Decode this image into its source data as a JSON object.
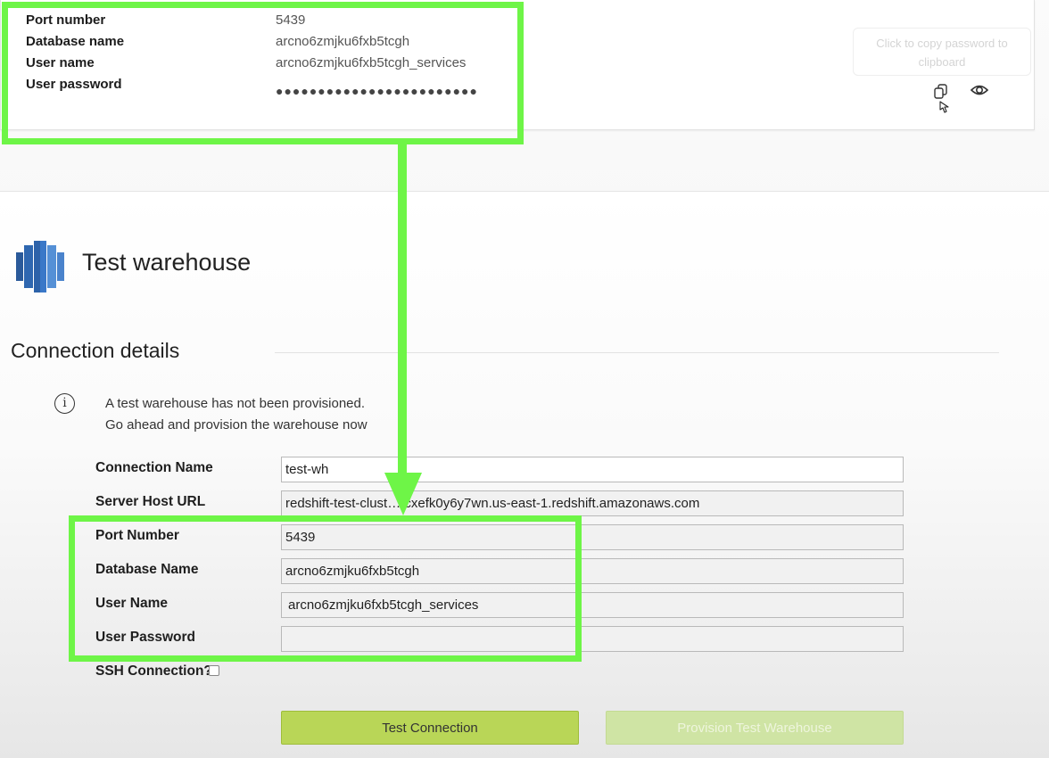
{
  "top_card": {
    "rows": [
      {
        "label": "Port number",
        "value": "5439"
      },
      {
        "label": "Database name",
        "value": "arcno6zmjku6fxb5tcgh"
      },
      {
        "label": "User name",
        "value": "arcno6zmjku6fxb5tcgh_services"
      },
      {
        "label": "User password",
        "value": "●●●●●●●●●●●●●●●●●●●●●●●●"
      }
    ],
    "copy_tooltip": "Click to copy password to clipboard",
    "icons": {
      "copy": "copy-icon",
      "show": "eye-icon"
    }
  },
  "warehouse": {
    "title": "Test warehouse",
    "icon": "redshift-logo-icon"
  },
  "connection": {
    "section_title": "Connection details",
    "info_line_1": "A test warehouse has not been provisioned.",
    "info_line_2": "Go ahead and provision the warehouse now",
    "fields": {
      "connection_name": {
        "label": "Connection Name",
        "value": "test-wh"
      },
      "server_host_url": {
        "label": "Server Host URL",
        "value": "redshift-test-clust….cxefk0y6y7wn.us-east-1.redshift.amazonaws.com"
      },
      "port_number": {
        "label": "Port Number",
        "value": "5439"
      },
      "database_name": {
        "label": "Database Name",
        "value": "arcno6zmjku6fxb5tcgh"
      },
      "user_name": {
        "label": "User Name",
        "value": "arcno6zmjku6fxb5tcgh_services"
      },
      "user_password": {
        "label": "User Password",
        "value": ""
      }
    },
    "ssh_label": "SSH Connection?",
    "ssh_checked": false,
    "test_button": "Test Connection",
    "provision_button": "Provision Test Warehouse"
  },
  "colors": {
    "highlight": "#6ef547",
    "test_button": "#b9d657",
    "provision_button_disabled": "#cfe4a4",
    "redshift_blue": "#3a6fb6"
  }
}
